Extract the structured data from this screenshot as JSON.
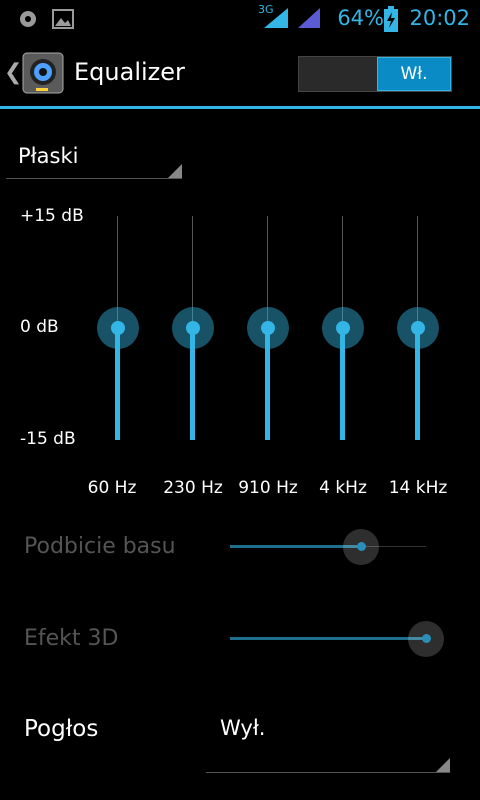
{
  "status_bar": {
    "left_icons": [
      "settings-icon",
      "image-icon"
    ],
    "network_type": "3G",
    "battery_percent": "64%",
    "time": "20:02",
    "accent": "#33b5e5"
  },
  "action_bar": {
    "title": "Equalizer",
    "toggle_label": "Wł.",
    "toggle_on": true,
    "app_icon": "speaker-icon"
  },
  "preset": {
    "selected": "Płaski"
  },
  "equalizer": {
    "db_max": "+15 dB",
    "db_mid": "0 dB",
    "db_min": "-15 dB",
    "range": [
      -15,
      15
    ],
    "bands": [
      {
        "freq": "60 Hz",
        "level_db": 0
      },
      {
        "freq": "230 Hz",
        "level_db": 0
      },
      {
        "freq": "910 Hz",
        "level_db": 0
      },
      {
        "freq": "4 kHz",
        "level_db": 0
      },
      {
        "freq": "14 kHz",
        "level_db": 0
      }
    ]
  },
  "effects": {
    "bass_boost": {
      "label": "Podbicie basu",
      "level": 0.67,
      "enabled": false
    },
    "virtualizer": {
      "label": "Efekt 3D",
      "level": 1.0,
      "enabled": false
    }
  },
  "reverb": {
    "label": "Pogłos",
    "value": "Wył."
  }
}
